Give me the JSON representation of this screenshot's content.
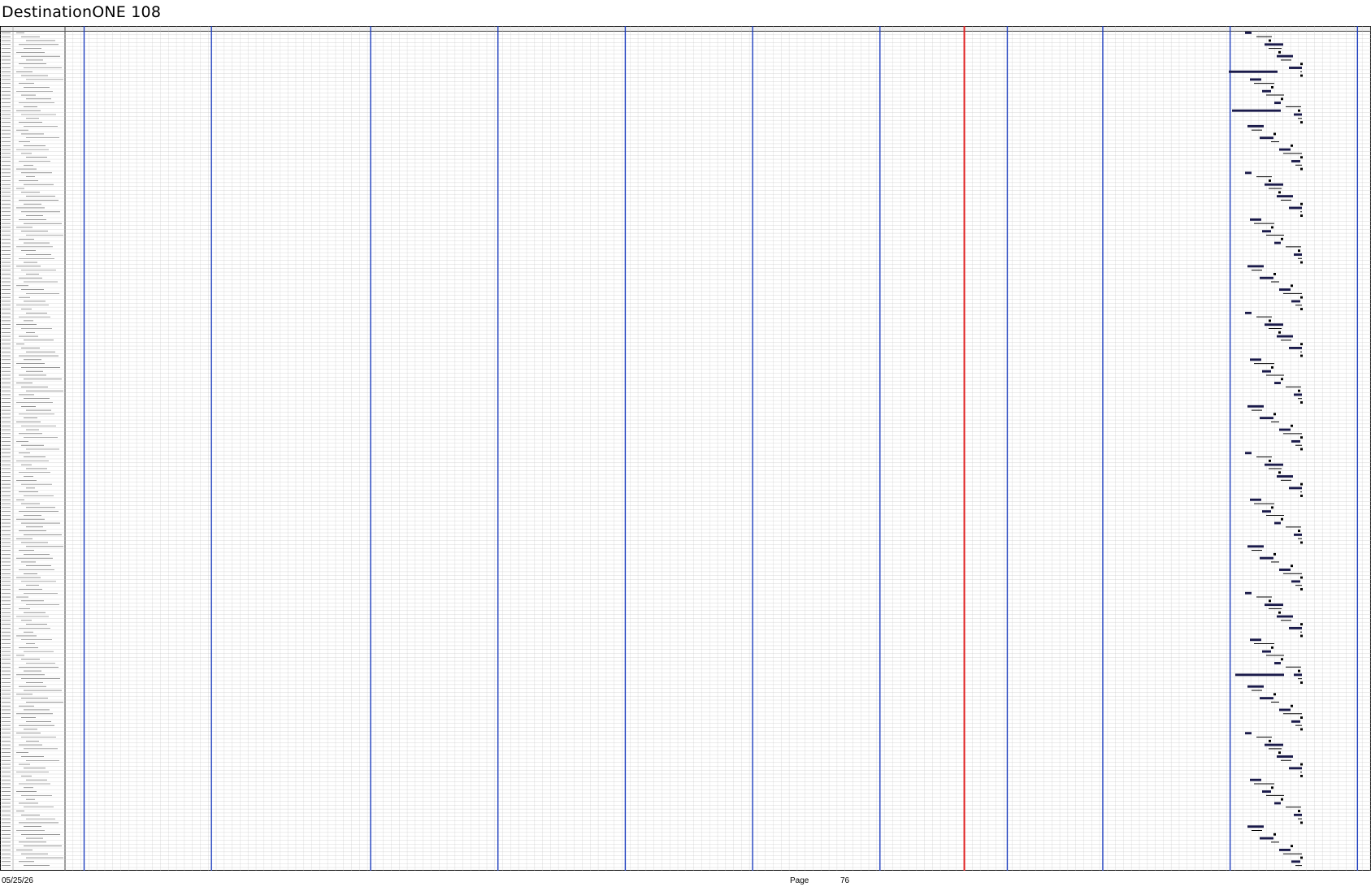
{
  "document": {
    "title": "DestinationONE 108",
    "print_date": "05/25/26",
    "page_label": "Page",
    "page_number": "76"
  },
  "colors": {
    "month_divider": "#1f3fbf",
    "today_marker": "#e02020",
    "grid": "#c8c8c8",
    "task_bar": "#1a1a4a",
    "summary_bar": "#000000"
  },
  "gantt": {
    "row_count": 215,
    "column_count": 41,
    "month_divider_columns": [
      0,
      4,
      9,
      13,
      17,
      21,
      25,
      29,
      32,
      36,
      40
    ],
    "today_column": 28
  }
}
